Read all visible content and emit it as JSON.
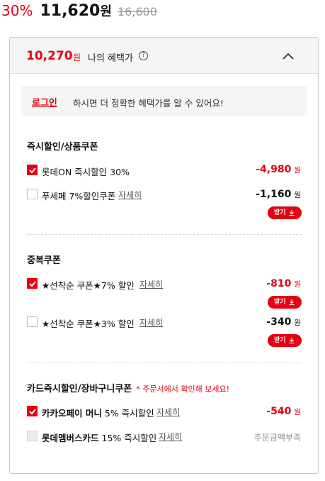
{
  "price": {
    "discount_rate": "30%",
    "sale_price": "11,620",
    "currency": "원",
    "original_price": "16,600"
  },
  "benefit_panel": {
    "my_price": "10,270",
    "currency": "원",
    "label": "나의 혜택가",
    "help_icon": "?",
    "collapse_icon": "chevron-up-icon"
  },
  "login_notice": {
    "link_text": "로그인",
    "message": "하시면 더 정확한 혜택가를 알 수 있어요!"
  },
  "sections": {
    "instant": {
      "title": "즉시할인/상품쿠폰",
      "items": [
        {
          "name": "롯데ON 즉시할인 30%",
          "amount": "-4,980",
          "unit": "원",
          "checked": true
        },
        {
          "name": "푸세페 7%할인쿠폰",
          "detail": "자세히",
          "amount": "-1,160",
          "unit": "원",
          "checked": false,
          "button": "받기"
        }
      ]
    },
    "stack": {
      "title": "중복쿠폰",
      "items": [
        {
          "name": "★선착순 쿠폰★7% 할인",
          "detail": "자세히",
          "amount": "-810",
          "unit": "원",
          "checked": true,
          "button": "받기"
        },
        {
          "name": "★선착순 쿠폰★3% 할인",
          "detail": "자세히",
          "amount": "-340",
          "unit": "원",
          "checked": false,
          "button": "받기"
        }
      ]
    },
    "card": {
      "title": "카드즉시할인/장바구니쿠폰",
      "note": "* 주문서에서 확인해 보세요!",
      "items": [
        {
          "brand": "카카오페이 머니",
          "name": "5% 즉시할인",
          "detail": "자세히",
          "amount": "-540",
          "unit": "원",
          "checked": true
        },
        {
          "brand": "롯데멤버스카드",
          "name": "15% 즉시할인",
          "detail": "자세히",
          "status": "주문금액부족",
          "checked": false,
          "disabled": true
        }
      ]
    }
  },
  "colors": {
    "accent": "#e60012",
    "panel_header_bg": "#f5f5f5",
    "border": "#c9c9c9",
    "muted": "#999999"
  }
}
